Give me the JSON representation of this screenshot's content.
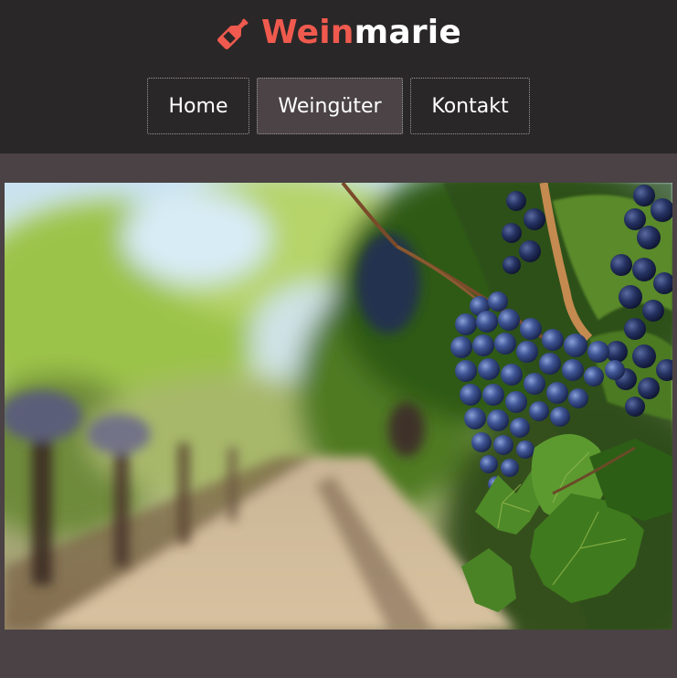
{
  "brand": {
    "name_part1": "Wein",
    "name_part2": "marie",
    "icon": "wine-bottle-icon",
    "accent_color": "#f05a4e"
  },
  "nav": {
    "items": [
      {
        "label": "Home",
        "active": false
      },
      {
        "label": "Weingüter",
        "active": true
      },
      {
        "label": "Kontakt",
        "active": false
      }
    ]
  },
  "colors": {
    "header_bg": "#2a2728",
    "page_bg": "#4a4244",
    "active_nav_bg": "#4b4345"
  }
}
